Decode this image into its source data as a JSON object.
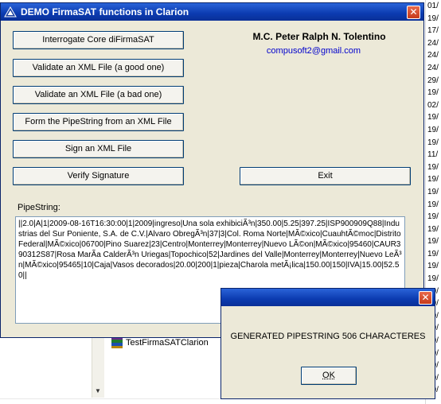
{
  "background": {
    "dates": [
      "01/",
      "19/",
      "17/",
      "24/",
      "24/",
      "24/",
      "29/",
      "19/",
      "02/",
      "19/",
      "19/",
      "19/",
      "11/",
      "19/",
      "19/",
      "19/",
      "19/",
      "19/",
      "19/",
      "19/",
      "19/",
      "19/",
      "19/",
      "19/",
      "19/",
      "19/",
      "19/",
      "19/",
      "19/",
      "19/",
      "19/",
      "19/"
    ],
    "file_name": "TestFirmaSATClarion"
  },
  "window": {
    "title": "DEMO FirmaSAT functions in Clarion",
    "buttons": {
      "interrogate": "Interrogate Core diFirmaSAT",
      "validate_good": "Validate an XML File (a good one)",
      "validate_bad": "Validate an XML File (a bad one)",
      "form_pipe": "Form the PipeString from an XML File",
      "sign_xml": "Sign an XML File",
      "verify": "Verify Signature",
      "exit": "Exit"
    },
    "author": "M.C. Peter Ralph N. Tolentino",
    "email": "compusoft2@gmail.com",
    "pipe_label": "PipeString:",
    "pipe_value": "||2.0|A|1|2009-08-16T16:30:00|1|2009|ingreso|Una sola exhibiciÃ³n|350.00|5.25|397.25|ISP900909Q88|Industrias del Sur Poniente, S.A. de C.V.|Alvaro ObregÃ³n|37|3|Col. Roma Norte|MÃ©xico|CuauhtÃ©moc|Distrito Federal|MÃ©xico|06700|Pino Suarez|23|Centro|Monterrey|Monterrey|Nuevo LÃ©on|MÃ©xico|95460|CAUR390312S87|Rosa MarÃ­a CalderÃ³n Uriegas|Topochico|52|Jardines del Valle|Monterrey|Monterrey|Nuevo LeÃ³n|MÃ©xico|95465|10|Caja|Vasos decorados|20.00|200|1|pieza|Charola metÃ¡lica|150.00|150|IVA|15.00|52.50||"
  },
  "dialog": {
    "message": "GENERATED PIPESTRING 506 CHARACTERES",
    "ok_label": "OK"
  }
}
